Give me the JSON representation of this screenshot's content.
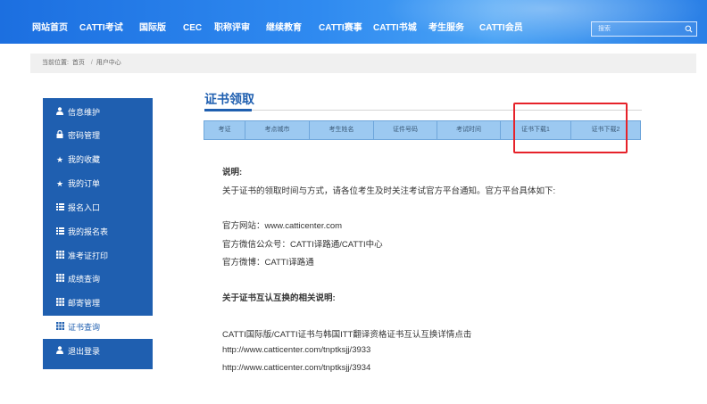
{
  "nav": {
    "items": [
      "网站首页",
      "CATTI考试",
      "国际版",
      "CEC",
      "职称评审",
      "继续教育",
      "CATTI赛事",
      "CATTI书城",
      "考生服务",
      "CATTI会员"
    ],
    "search_placeholder": "搜索"
  },
  "breadcrumb": {
    "prefix": "当前位置:",
    "home": "首页",
    "separator": "/",
    "current": "用户中心"
  },
  "sidebar": {
    "items": [
      {
        "icon": "user-icon",
        "label": "信息维护"
      },
      {
        "icon": "lock-icon",
        "label": "密码管理"
      },
      {
        "icon": "star-icon",
        "label": "我的收藏"
      },
      {
        "icon": "star-icon",
        "label": "我的订单"
      },
      {
        "icon": "list-icon",
        "label": "报名入口"
      },
      {
        "icon": "list-icon",
        "label": "我的报名表"
      },
      {
        "icon": "grid-icon",
        "label": "准考证打印"
      },
      {
        "icon": "grid-icon",
        "label": "成绩查询"
      },
      {
        "icon": "grid-icon",
        "label": "邮寄管理"
      },
      {
        "icon": "grid-icon",
        "label": "证书查询"
      },
      {
        "icon": "user-icon",
        "label": "退出登录"
      }
    ],
    "active_index": 9
  },
  "main": {
    "title": "证书领取",
    "table_headers": [
      "考证",
      "考点城市",
      "考生姓名",
      "证件号码",
      "考试时间",
      "证书下载1",
      "证书下载2"
    ],
    "notes": {
      "heading": "说明:",
      "intro": "关于证书的领取时间与方式，请各位考生及时关注考试官方平台通知。官方平台具体如下:",
      "website": "官方网站：www.catticenter.com",
      "wechat": "官方微信公众号：CATTI译路通/CATTI中心",
      "weibo": "官方微博：CATTI译路通",
      "mutual_heading": "关于证书互认互换的相关说明:",
      "mutual_text": "CATTI国际版/CATTI证书与韩国ITT翻译资格证书互认互换详情点击",
      "link1": "http://www.catticenter.com/tnptksjj/3933",
      "link2": "http://www.catticenter.com/tnptksjj/3934"
    }
  },
  "colors": {
    "nav_blue": "#1c6fe0",
    "sidebar_blue": "#1f5fb0",
    "table_header": "#9cc9f1",
    "highlight_red": "#e6222a"
  }
}
